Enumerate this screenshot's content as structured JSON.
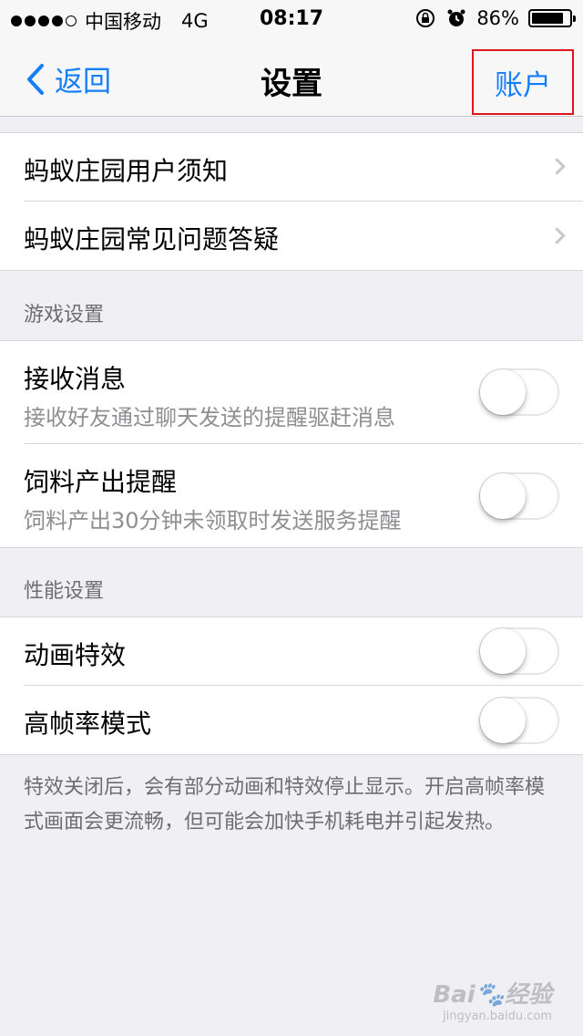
{
  "status_bar": {
    "carrier": "中国移动",
    "network": "4G",
    "time": "08:17",
    "battery": "86%",
    "battery_level": 0.86
  },
  "nav": {
    "back_label": "返回",
    "title": "设置",
    "account_label": "账户"
  },
  "links": [
    {
      "label": "蚂蚁庄园用户须知"
    },
    {
      "label": "蚂蚁庄园常见问题答疑"
    }
  ],
  "game_settings": {
    "header": "游戏设置",
    "items": [
      {
        "label": "接收消息",
        "description": "接收好友通过聊天发送的提醒驱赶消息",
        "enabled": false
      },
      {
        "label": "饲料产出提醒",
        "description": "饲料产出30分钟未领取时发送服务提醒",
        "enabled": false
      }
    ]
  },
  "performance_settings": {
    "header": "性能设置",
    "items": [
      {
        "label": "动画特效",
        "enabled": false
      },
      {
        "label": "高帧率模式",
        "enabled": false
      }
    ],
    "footer": "特效关闭后，会有部分动画和特效停止显示。开启高帧率模式画面会更流畅，但可能会加快手机耗电并引起发热。"
  },
  "watermark": {
    "logo": "Bai🐾经验",
    "url": "jingyan.baidu.com"
  },
  "colors": {
    "accent": "#157efb",
    "highlight_box": "#e0141b",
    "background": "#efeff4"
  }
}
